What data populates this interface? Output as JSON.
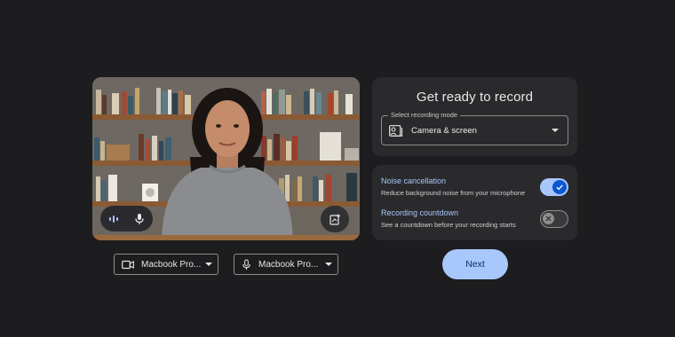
{
  "preview": {
    "audio_level_icon": "audio-level-icon",
    "mic_icon": "mic-icon",
    "add_icon": "add-note-icon"
  },
  "devices": {
    "camera": {
      "label": "Macbook Pro...",
      "icon": "camera-icon"
    },
    "microphone": {
      "label": "Macbook Pro...",
      "icon": "mic-icon"
    }
  },
  "setup": {
    "title": "Get ready to record",
    "mode_legend": "Select recording mode",
    "mode_value": "Camera & screen",
    "mode_icon": "camera-screen-icon"
  },
  "options": {
    "noise": {
      "title": "Noise cancellation",
      "desc": "Reduce background noise from your microphone",
      "enabled": true
    },
    "countdown": {
      "title": "Recording countdown",
      "desc": "See a countdown before your recording starts",
      "enabled": false
    }
  },
  "actions": {
    "next_label": "Next"
  },
  "colors": {
    "background": "#1d1d1f",
    "panel": "#2a2a2d",
    "accent": "#a8c7fa",
    "accent_dark": "#0b57d0"
  }
}
